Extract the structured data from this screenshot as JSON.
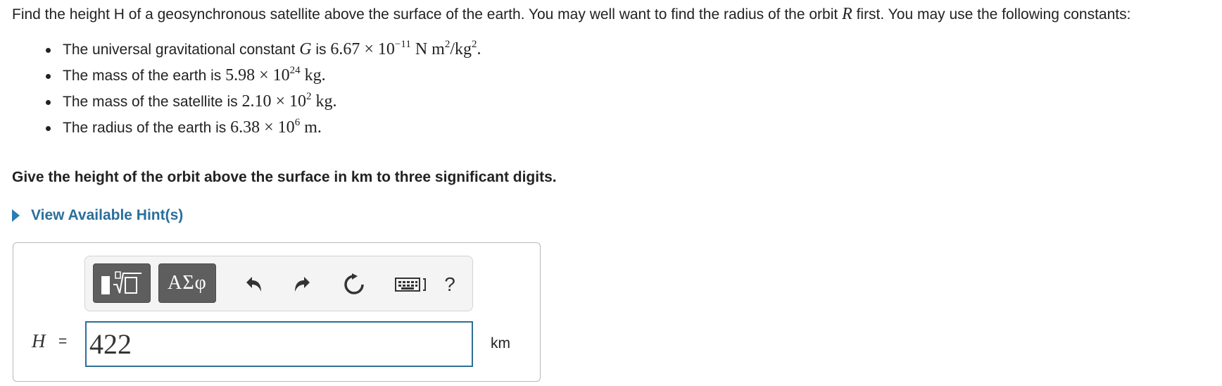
{
  "problem": {
    "intro_part1": "Find the height H of a geosynchronous satellite above the surface of the earth. You may well want to find the radius of the orbit ",
    "orbit_symbol": "R",
    "intro_part2": " first. You may use the following constants:",
    "constants": [
      {
        "text": "The universal gravitational constant ",
        "symbol": "G",
        "mid": " is ",
        "mantissa": "6.67 × 10",
        "exponent": "−11",
        "unit": " N m",
        "unit_exp": "2",
        "unit_tail": "/kg",
        "unit_tail_exp": "2",
        "end": "."
      },
      {
        "text": "The mass of the earth is ",
        "mantissa": "5.98 × 10",
        "exponent": "24",
        "unit": " kg."
      },
      {
        "text": "The mass of the satellite is ",
        "mantissa": "2.10 × 10",
        "exponent": "2",
        "unit": " kg."
      },
      {
        "text": "The radius of the earth is ",
        "mantissa": "6.38 × 10",
        "exponent": "6",
        "unit": " m."
      }
    ],
    "instruction": "Give the height of the orbit above the surface in km to three significant digits."
  },
  "hints": {
    "toggle_label": "View Available Hint(s)"
  },
  "toolbar": {
    "symbols_label": "ΑΣφ",
    "help_label": "?"
  },
  "answer": {
    "variable": "H",
    "equals": "=",
    "value": "422",
    "unit": "km"
  },
  "colors": {
    "accent": "#2a6f9b",
    "input_border": "#2d6f95",
    "button_dark": "#5e5e5e"
  }
}
